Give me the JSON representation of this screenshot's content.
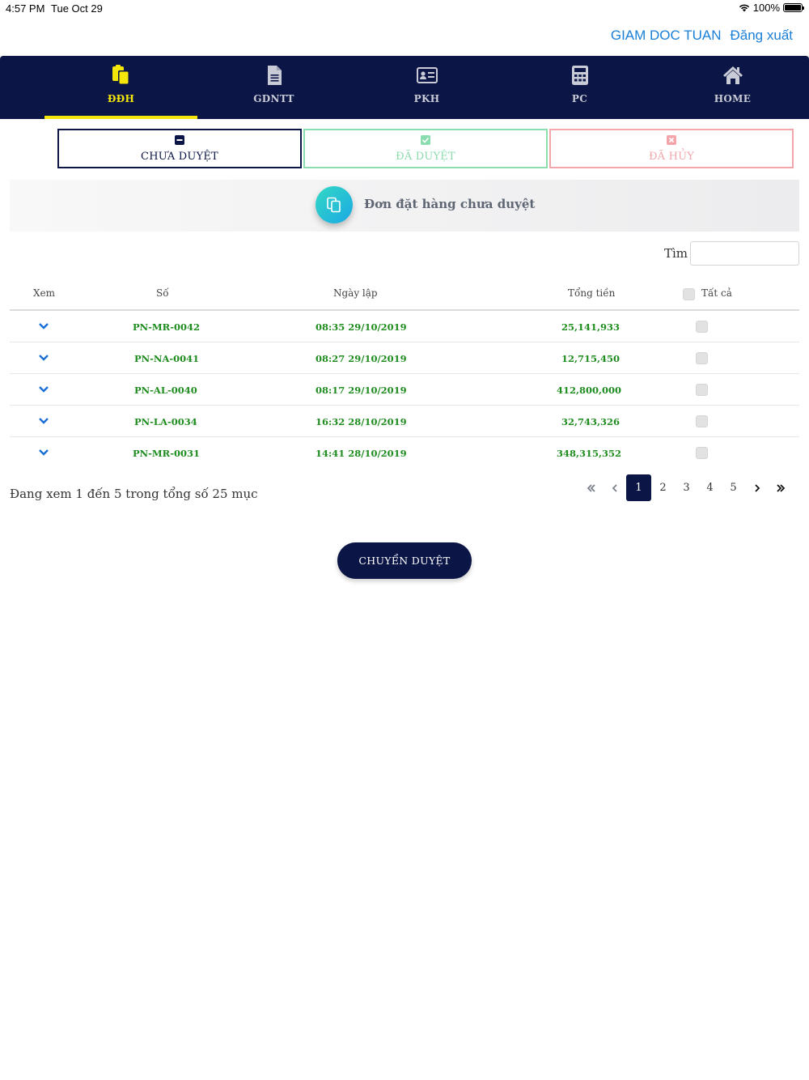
{
  "status_bar": {
    "time": "4:57 PM",
    "date": "Tue Oct 29",
    "battery": "100%"
  },
  "user": {
    "name": "GIAM DOC TUAN",
    "logout": "Đăng xuất"
  },
  "nav": [
    {
      "label": "ĐĐH",
      "icon": "clipboard-copy-icon",
      "active": true
    },
    {
      "label": "GDNTT",
      "icon": "document-icon",
      "active": false
    },
    {
      "label": "PKH",
      "icon": "id-card-icon",
      "active": false
    },
    {
      "label": "PC",
      "icon": "calculator-icon",
      "active": false
    },
    {
      "label": "HOME",
      "icon": "home-icon",
      "active": false
    }
  ],
  "status_tabs": [
    {
      "label": "CHƯA DUYỆT",
      "icon": "minus-square-icon",
      "color": "#0b1646"
    },
    {
      "label": "ĐÃ DUYỆT",
      "icon": "check-square-icon",
      "color": "#8bdcae"
    },
    {
      "label": "ĐÃ HỦY",
      "icon": "x-square-icon",
      "color": "#f2a6ab"
    }
  ],
  "section": {
    "title": "Đơn đặt hàng chưa duyệt",
    "icon": "copy-icon"
  },
  "search": {
    "label": "Tìm",
    "value": ""
  },
  "table": {
    "headers": {
      "view": "Xem",
      "number": "Số",
      "date": "Ngày lập",
      "total": "Tổng tiền",
      "all": "Tất cả"
    },
    "rows": [
      {
        "number": "PN-MR-0042",
        "date": "08:35 29/10/2019",
        "total": "25,141,933"
      },
      {
        "number": "PN-NA-0041",
        "date": "08:27 29/10/2019",
        "total": "12,715,450"
      },
      {
        "number": "PN-AL-0040",
        "date": "08:17 29/10/2019",
        "total": "412,800,000"
      },
      {
        "number": "PN-LA-0034",
        "date": "16:32 28/10/2019",
        "total": "32,743,326"
      },
      {
        "number": "PN-MR-0031",
        "date": "14:41 28/10/2019",
        "total": "348,315,352"
      }
    ]
  },
  "summary": "Đang xem 1 đến 5 trong tổng số 25 mục",
  "pagination": {
    "pages": [
      "1",
      "2",
      "3",
      "4",
      "5"
    ],
    "current": "1"
  },
  "submit_label": "CHUYỂN DUYỆT",
  "colors": {
    "navy": "#0b1646",
    "accent_yellow": "#f5e60a",
    "link_blue": "#1a7fd6",
    "value_green": "#1e8c1e"
  }
}
